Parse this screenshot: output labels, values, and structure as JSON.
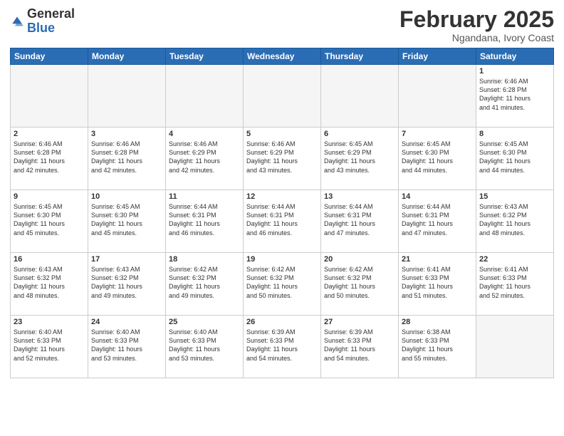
{
  "header": {
    "logo_general": "General",
    "logo_blue": "Blue",
    "month_title": "February 2025",
    "location": "Ngandana, Ivory Coast"
  },
  "weekdays": [
    "Sunday",
    "Monday",
    "Tuesday",
    "Wednesday",
    "Thursday",
    "Friday",
    "Saturday"
  ],
  "weeks": [
    [
      {
        "day": "",
        "info": ""
      },
      {
        "day": "",
        "info": ""
      },
      {
        "day": "",
        "info": ""
      },
      {
        "day": "",
        "info": ""
      },
      {
        "day": "",
        "info": ""
      },
      {
        "day": "",
        "info": ""
      },
      {
        "day": "1",
        "info": "Sunrise: 6:46 AM\nSunset: 6:28 PM\nDaylight: 11 hours\nand 41 minutes."
      }
    ],
    [
      {
        "day": "2",
        "info": "Sunrise: 6:46 AM\nSunset: 6:28 PM\nDaylight: 11 hours\nand 42 minutes."
      },
      {
        "day": "3",
        "info": "Sunrise: 6:46 AM\nSunset: 6:28 PM\nDaylight: 11 hours\nand 42 minutes."
      },
      {
        "day": "4",
        "info": "Sunrise: 6:46 AM\nSunset: 6:29 PM\nDaylight: 11 hours\nand 42 minutes."
      },
      {
        "day": "5",
        "info": "Sunrise: 6:46 AM\nSunset: 6:29 PM\nDaylight: 11 hours\nand 43 minutes."
      },
      {
        "day": "6",
        "info": "Sunrise: 6:45 AM\nSunset: 6:29 PM\nDaylight: 11 hours\nand 43 minutes."
      },
      {
        "day": "7",
        "info": "Sunrise: 6:45 AM\nSunset: 6:30 PM\nDaylight: 11 hours\nand 44 minutes."
      },
      {
        "day": "8",
        "info": "Sunrise: 6:45 AM\nSunset: 6:30 PM\nDaylight: 11 hours\nand 44 minutes."
      }
    ],
    [
      {
        "day": "9",
        "info": "Sunrise: 6:45 AM\nSunset: 6:30 PM\nDaylight: 11 hours\nand 45 minutes."
      },
      {
        "day": "10",
        "info": "Sunrise: 6:45 AM\nSunset: 6:30 PM\nDaylight: 11 hours\nand 45 minutes."
      },
      {
        "day": "11",
        "info": "Sunrise: 6:44 AM\nSunset: 6:31 PM\nDaylight: 11 hours\nand 46 minutes."
      },
      {
        "day": "12",
        "info": "Sunrise: 6:44 AM\nSunset: 6:31 PM\nDaylight: 11 hours\nand 46 minutes."
      },
      {
        "day": "13",
        "info": "Sunrise: 6:44 AM\nSunset: 6:31 PM\nDaylight: 11 hours\nand 47 minutes."
      },
      {
        "day": "14",
        "info": "Sunrise: 6:44 AM\nSunset: 6:31 PM\nDaylight: 11 hours\nand 47 minutes."
      },
      {
        "day": "15",
        "info": "Sunrise: 6:43 AM\nSunset: 6:32 PM\nDaylight: 11 hours\nand 48 minutes."
      }
    ],
    [
      {
        "day": "16",
        "info": "Sunrise: 6:43 AM\nSunset: 6:32 PM\nDaylight: 11 hours\nand 48 minutes."
      },
      {
        "day": "17",
        "info": "Sunrise: 6:43 AM\nSunset: 6:32 PM\nDaylight: 11 hours\nand 49 minutes."
      },
      {
        "day": "18",
        "info": "Sunrise: 6:42 AM\nSunset: 6:32 PM\nDaylight: 11 hours\nand 49 minutes."
      },
      {
        "day": "19",
        "info": "Sunrise: 6:42 AM\nSunset: 6:32 PM\nDaylight: 11 hours\nand 50 minutes."
      },
      {
        "day": "20",
        "info": "Sunrise: 6:42 AM\nSunset: 6:32 PM\nDaylight: 11 hours\nand 50 minutes."
      },
      {
        "day": "21",
        "info": "Sunrise: 6:41 AM\nSunset: 6:33 PM\nDaylight: 11 hours\nand 51 minutes."
      },
      {
        "day": "22",
        "info": "Sunrise: 6:41 AM\nSunset: 6:33 PM\nDaylight: 11 hours\nand 52 minutes."
      }
    ],
    [
      {
        "day": "23",
        "info": "Sunrise: 6:40 AM\nSunset: 6:33 PM\nDaylight: 11 hours\nand 52 minutes."
      },
      {
        "day": "24",
        "info": "Sunrise: 6:40 AM\nSunset: 6:33 PM\nDaylight: 11 hours\nand 53 minutes."
      },
      {
        "day": "25",
        "info": "Sunrise: 6:40 AM\nSunset: 6:33 PM\nDaylight: 11 hours\nand 53 minutes."
      },
      {
        "day": "26",
        "info": "Sunrise: 6:39 AM\nSunset: 6:33 PM\nDaylight: 11 hours\nand 54 minutes."
      },
      {
        "day": "27",
        "info": "Sunrise: 6:39 AM\nSunset: 6:33 PM\nDaylight: 11 hours\nand 54 minutes."
      },
      {
        "day": "28",
        "info": "Sunrise: 6:38 AM\nSunset: 6:33 PM\nDaylight: 11 hours\nand 55 minutes."
      },
      {
        "day": "",
        "info": ""
      }
    ]
  ]
}
